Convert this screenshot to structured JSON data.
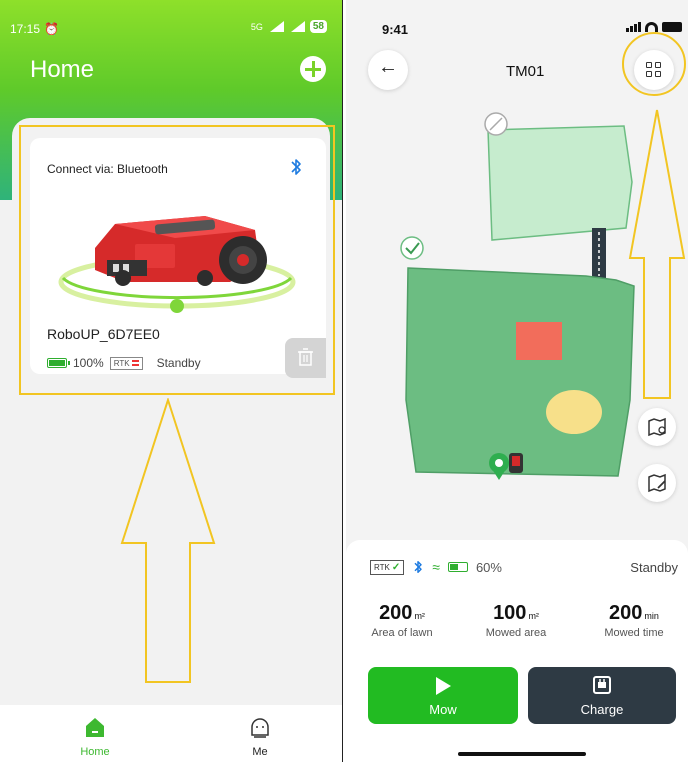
{
  "left": {
    "status_time": "17:15",
    "status_signal": "5G",
    "status_battery": "58",
    "title": "Home",
    "device": {
      "connect_label": "Connect via: Bluetooth",
      "name": "RoboUP_6D7EE0",
      "battery": "100%",
      "rtk": "RTK",
      "state": "Standby"
    },
    "tabs": [
      {
        "label": "Home",
        "icon": "home-icon"
      },
      {
        "label": "Me",
        "icon": "user-face-icon"
      }
    ]
  },
  "right": {
    "status_time": "9:41",
    "title": "TM01",
    "status": {
      "rtk": "RTK",
      "battery": "60%",
      "state": "Standby"
    },
    "stats": [
      {
        "value": "200",
        "unit": "m²",
        "label": "Area of lawn"
      },
      {
        "value": "100",
        "unit": "m²",
        "label": "Mowed area"
      },
      {
        "value": "200",
        "unit": "min",
        "label": "Mowed time"
      }
    ],
    "actions": {
      "mow": "Mow",
      "charge": "Charge"
    }
  },
  "colors": {
    "accent_green": "#22bb22",
    "highlight_yellow": "#f2c522",
    "dark_button": "#2e3a44",
    "lawn_green": "#6cbd82",
    "lawn_light": "#c6ecce",
    "obstacle_red": "#f26d5b",
    "zone_yellow": "#f7e08a"
  }
}
